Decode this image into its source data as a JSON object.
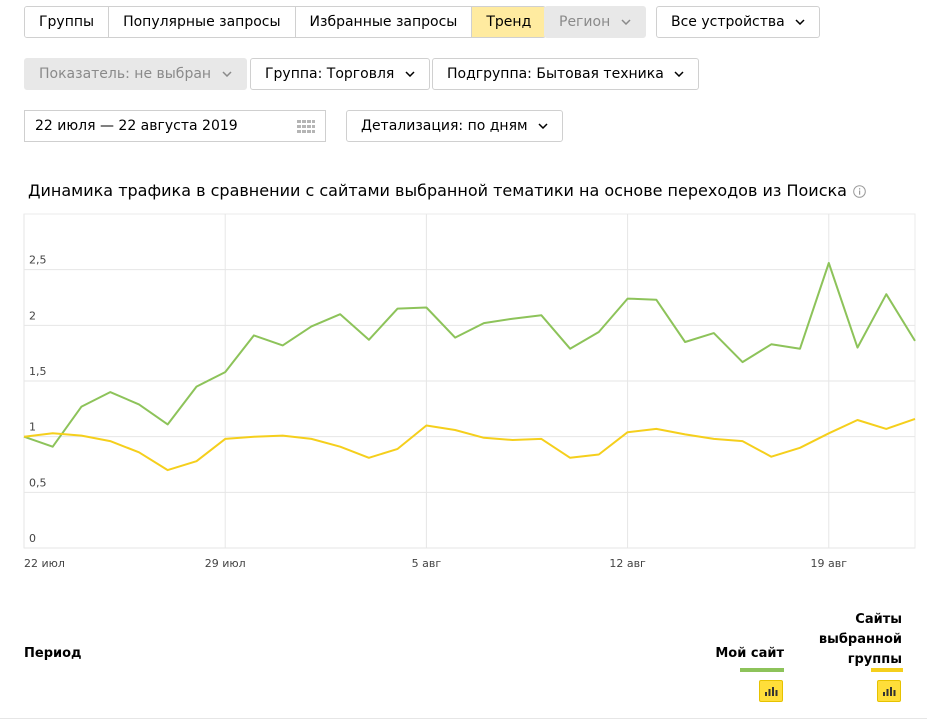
{
  "tabs": [
    {
      "label": "Группы",
      "active": false
    },
    {
      "label": "Популярные запросы",
      "active": false
    },
    {
      "label": "Избранные запросы",
      "active": false
    },
    {
      "label": "Тренд",
      "active": true
    }
  ],
  "filters": {
    "region": "Регион",
    "devices": "Все устройства",
    "indicator": "Показатель: не выбран",
    "group": "Группа: Торговля",
    "subgroup": "Подгруппа: Бытовая техника",
    "date_range": "22 июля — 22 августа 2019",
    "detail": "Детализация: по дням"
  },
  "chart_title": "Динамика трафика в сравнении с сайтами выбранной тематики на основе переходов из Поиска",
  "chart_data": {
    "type": "line",
    "ylim": [
      0,
      3
    ],
    "y_ticks": [
      "0",
      "0,5",
      "1",
      "1,5",
      "2",
      "2,5"
    ],
    "y_tick_values": [
      0,
      0.5,
      1,
      1.5,
      2,
      2.5
    ],
    "x_ticks": [
      "22 июл",
      "29 июл",
      "5 авг",
      "12 авг",
      "19 авг"
    ],
    "x_tick_days": [
      0,
      7,
      14,
      21,
      28
    ],
    "x_days": [
      0,
      1,
      2,
      3,
      4,
      5,
      6,
      7,
      8,
      9,
      10,
      11,
      12,
      13,
      14,
      15,
      16,
      17,
      18,
      19,
      20,
      21,
      22,
      23,
      24,
      25,
      26,
      27,
      28,
      29,
      30,
      31
    ],
    "series": [
      {
        "name": "Мой сайт",
        "color": "#8dc35a",
        "values": [
          1.0,
          0.91,
          1.27,
          1.4,
          1.29,
          1.11,
          1.45,
          1.58,
          1.91,
          1.82,
          1.99,
          2.1,
          1.87,
          2.15,
          2.16,
          1.89,
          2.02,
          2.06,
          2.09,
          1.79,
          1.94,
          2.24,
          2.23,
          1.85,
          1.93,
          1.67,
          1.83,
          1.79,
          2.56,
          1.8,
          2.28,
          1.86
        ]
      },
      {
        "name": "Сайты выбранной группы",
        "color": "#f5cf1c",
        "values": [
          1.0,
          1.03,
          1.01,
          0.96,
          0.86,
          0.7,
          0.78,
          0.98,
          1.0,
          1.01,
          0.98,
          0.91,
          0.81,
          0.89,
          1.1,
          1.06,
          0.99,
          0.97,
          0.98,
          0.81,
          0.84,
          1.04,
          1.07,
          1.02,
          0.98,
          0.96,
          0.82,
          0.9,
          1.03,
          1.15,
          1.07,
          1.16
        ]
      }
    ]
  },
  "table": {
    "period_label": "Период",
    "my_site_label": "Мой сайт",
    "group_sites_label": "Сайты выбранной группы",
    "my_site_color": "#8dc35a",
    "group_color": "#f5cf1c"
  }
}
